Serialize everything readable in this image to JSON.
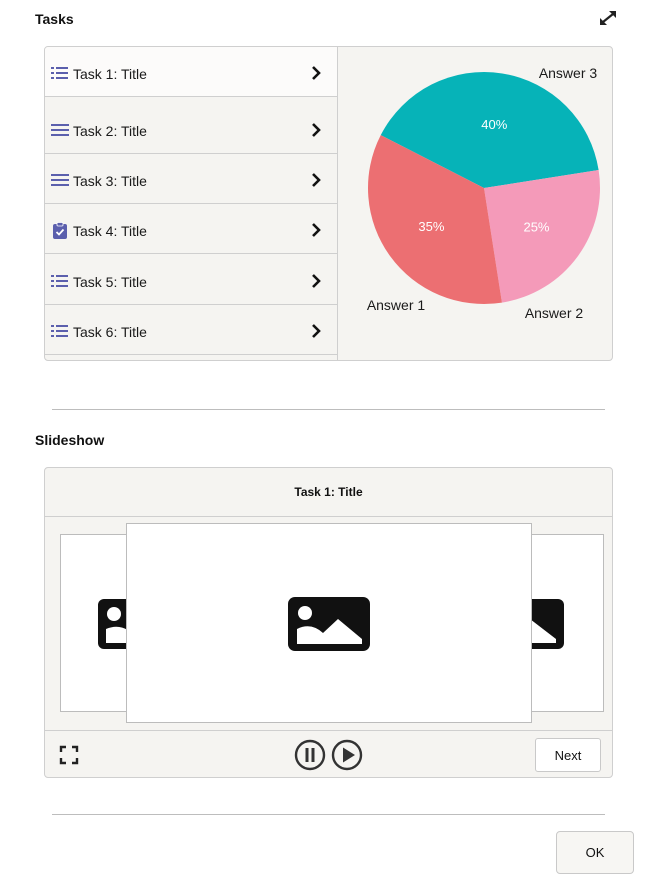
{
  "tasks_section": {
    "title": "Tasks",
    "expand_icon": "expand-arrows-icon"
  },
  "task_list": [
    {
      "label": "Task 1: Title",
      "icon": "list-icon",
      "selected": true
    },
    {
      "label": "Task 2: Title",
      "icon": "menu-lines-icon",
      "selected": false
    },
    {
      "label": "Task 3: Title",
      "icon": "menu-lines-icon",
      "selected": false
    },
    {
      "label": "Task 4: Title",
      "icon": "clipboard-check-icon",
      "selected": false
    },
    {
      "label": "Task 5: Title",
      "icon": "list-icon",
      "selected": false
    },
    {
      "label": "Task 6: Title",
      "icon": "list-icon",
      "selected": false
    }
  ],
  "chart_data": {
    "type": "pie",
    "slices": [
      {
        "label": "Answer 3",
        "value": 40,
        "value_label": "40%",
        "color": "#06b3b8"
      },
      {
        "label": "Answer 2",
        "value": 25,
        "value_label": "25%",
        "color": "#f49ab9"
      },
      {
        "label": "Answer 1",
        "value": 35,
        "value_label": "35%",
        "color": "#ec6f72"
      }
    ]
  },
  "slideshow": {
    "title": "Slideshow",
    "current_title": "Task 1: Title",
    "image_icon": "image-placeholder-icon",
    "fullscreen_icon": "fullscreen-icon",
    "pause_icon": "pause-icon",
    "play_icon": "play-icon",
    "next_label": "Next"
  },
  "footer": {
    "ok_label": "OK"
  },
  "colors": {
    "accent_icon": "#5b5fad",
    "panel_bg": "#f5f4f1"
  }
}
